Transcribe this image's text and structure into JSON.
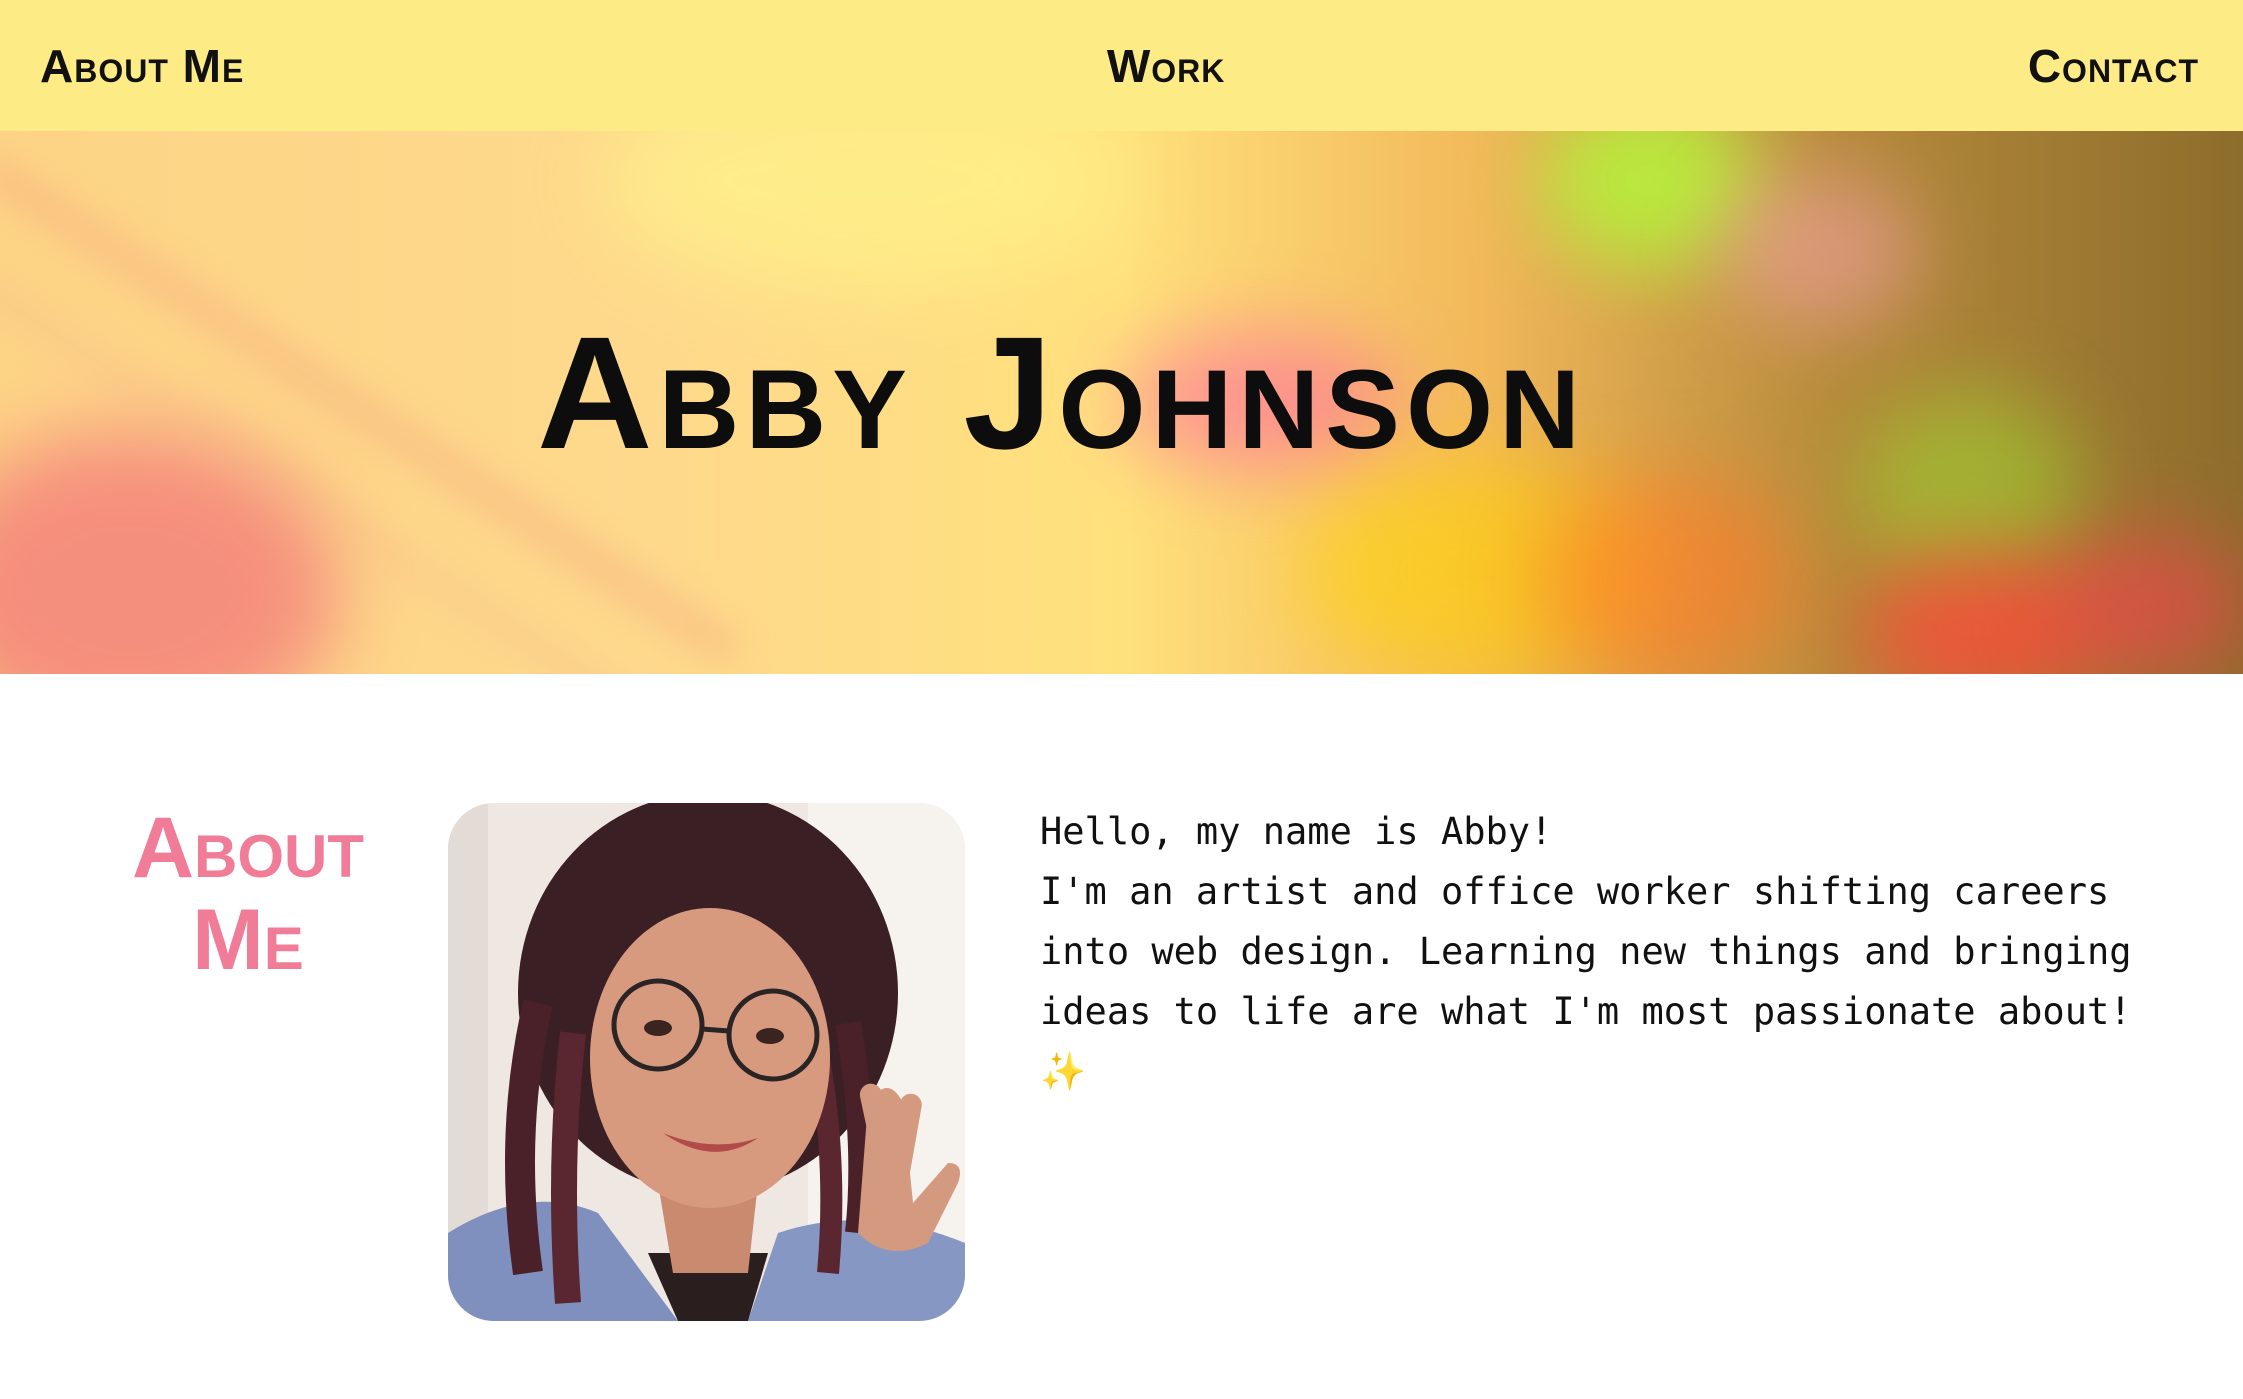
{
  "nav": {
    "items": [
      {
        "label": "About Me"
      },
      {
        "label": "Work"
      },
      {
        "label": "Contact"
      }
    ]
  },
  "hero": {
    "title": "Abby Johnson"
  },
  "about": {
    "heading_line1": "About",
    "heading_line2": "Me",
    "greeting": "Hello, my name is Abby!",
    "bio": "I'm an artist and office worker shifting careers into web design. Learning new things and bringing ideas to life are what I'm most passionate about!",
    "emoji": "✨"
  },
  "colors": {
    "nav_bg": "#fdec85",
    "accent_pink": "#f07c98",
    "text": "#111111"
  },
  "icons": {
    "sparkle": "sparkles-emoji"
  }
}
